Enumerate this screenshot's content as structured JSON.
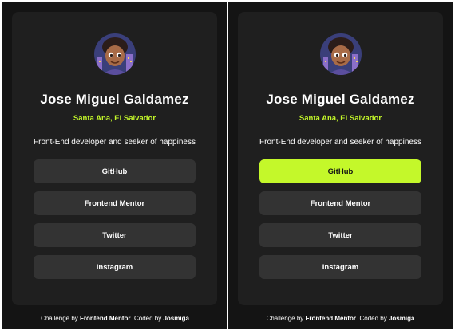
{
  "profile": {
    "name": "Jose Miguel Galdamez",
    "location": "Santa Ana, El Salvador",
    "bio": "Front-End developer and seeker of happiness"
  },
  "links": [
    "GitHub",
    "Frontend Mentor",
    "Twitter",
    "Instagram"
  ],
  "footer": {
    "prefix": "Challenge by ",
    "challenge_link": "Frontend Mentor",
    "middle": ". Coded by ",
    "author_link": "Josmiga"
  },
  "states": {
    "left_card": "default",
    "right_card": "GitHub button hovered"
  },
  "colors": {
    "background": "#141414",
    "card": "#1f1f1f",
    "button": "#333333",
    "accent": "#c4f82a",
    "text": "#ffffff"
  },
  "icons": {
    "avatar": "profile-avatar-illustration"
  }
}
